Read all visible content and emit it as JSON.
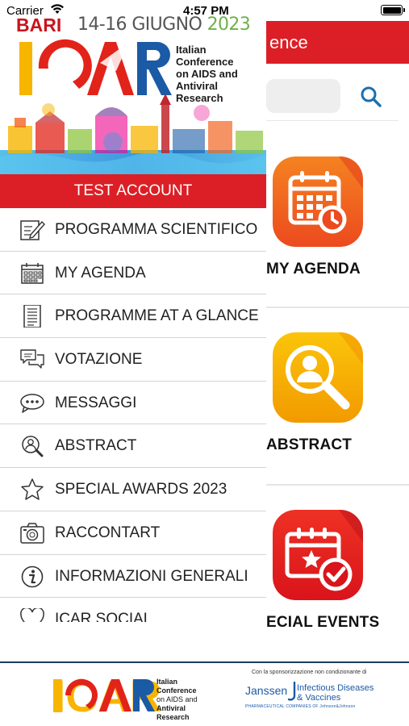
{
  "status_bar": {
    "carrier": "Carrier",
    "time": "4:57 PM"
  },
  "background": {
    "header_title": "ence",
    "tiles": [
      {
        "label": "MY AGENDA",
        "icon": "calendar-clock-icon"
      },
      {
        "label": "ABSTRACT",
        "icon": "person-search-icon"
      },
      {
        "label": "ECIAL EVENTS",
        "icon": "calendar-star-icon"
      }
    ],
    "colors": {
      "header": "#dc1f26",
      "tile_orange": "#f26522",
      "tile_yellow": "#f7b500",
      "tile_red": "#e2231a"
    }
  },
  "drawer": {
    "banner": {
      "city": "BARI",
      "date_range": "14-16 GIUGNO",
      "year": "2023",
      "logo_text": "ICAR",
      "tagline_lines": [
        "Italian",
        "Conference",
        "on AIDS and",
        "Antiviral",
        "Research"
      ]
    },
    "user": "TEST ACCOUNT",
    "menu": [
      {
        "label": "PROGRAMMA SCIENTIFICO",
        "icon": "notepad-pencil-icon"
      },
      {
        "label": "MY AGENDA",
        "icon": "calendar-icon"
      },
      {
        "label": "PROGRAMME AT A GLANCE",
        "icon": "document-lines-icon"
      },
      {
        "label": "VOTAZIONE",
        "icon": "chat-bubbles-icon"
      },
      {
        "label": "MESSAGGI",
        "icon": "message-dots-icon"
      },
      {
        "label": "ABSTRACT",
        "icon": "person-search-icon"
      },
      {
        "label": "SPECIAL AWARDS 2023",
        "icon": "star-icon"
      },
      {
        "label": "RACCONTART",
        "icon": "camera-icon"
      },
      {
        "label": "INFORMAZIONI GENERALI",
        "icon": "info-icon"
      },
      {
        "label": "ICAR SOCIAL",
        "icon": "heart-icon"
      }
    ]
  },
  "footer": {
    "logo_text": "ICAR",
    "logo_tagline_lines": [
      "Italian",
      "Conference",
      "on AIDS and",
      "Antiviral",
      "Research"
    ],
    "sponsor_note": "Con la sponsorizzazione non condizionante di",
    "sponsor_name": "Janssen",
    "sponsor_tagline_lines": [
      "Infectious Diseases",
      "& Vaccines"
    ],
    "sponsor_sub": "PHARMACEUTICAL COMPANIES OF Johnson&Johnson"
  }
}
